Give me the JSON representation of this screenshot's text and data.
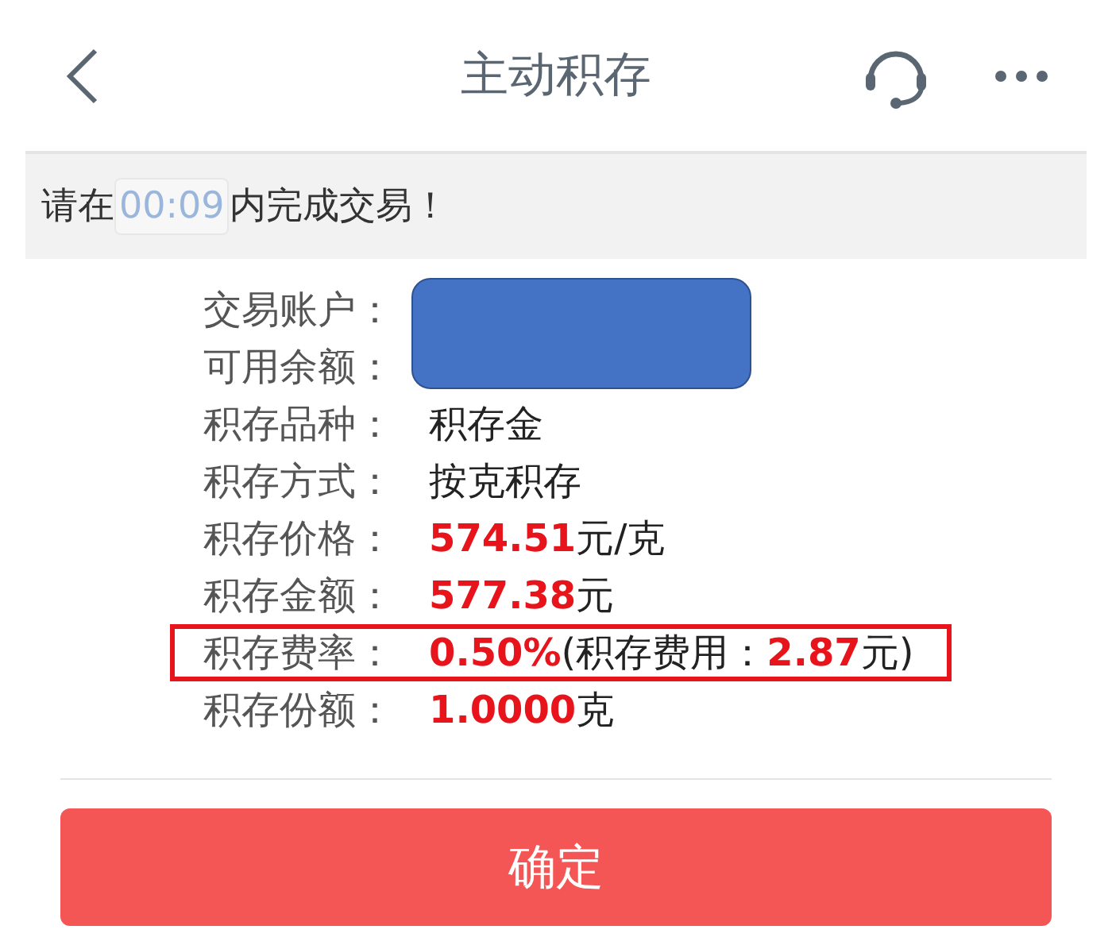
{
  "header": {
    "title": "主动积存"
  },
  "notice": {
    "before": "请在",
    "timer": "00:09",
    "after": "内完成交易！"
  },
  "account_rows": {
    "masked": true,
    "rows": [
      {
        "label": "交易账户："
      },
      {
        "label": "可用余额："
      }
    ]
  },
  "rows": [
    {
      "label": "积存品种：",
      "outlined": false,
      "value": "积存金"
    },
    {
      "label": "积存方式：",
      "outlined": false,
      "value": "按克积存"
    },
    {
      "label": "积存价格：",
      "outlined": false,
      "value": "**574.51**元/克"
    },
    {
      "label": "积存金额：",
      "outlined": false,
      "value": "**577.38**元"
    },
    {
      "label": "积存费率：",
      "outlined": true,
      "value": "**0.50%**(积存费用：**2.87**元)"
    },
    {
      "label": "积存份额：",
      "outlined": false,
      "value": "**1.0000**克"
    }
  ],
  "confirm_button": "确定"
}
